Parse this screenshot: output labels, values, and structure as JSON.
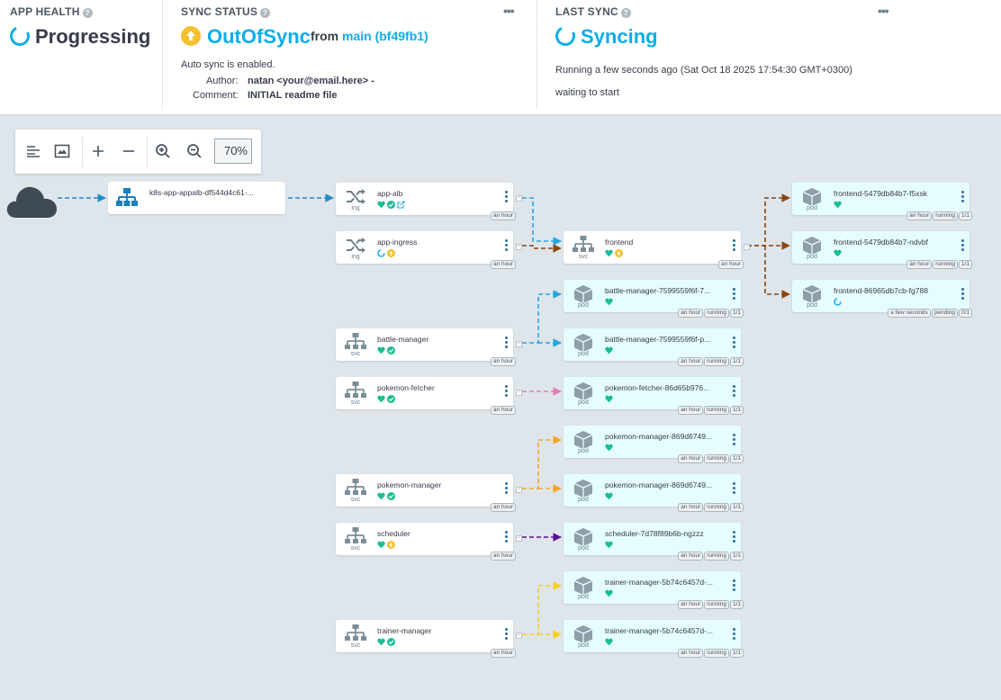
{
  "app_health": {
    "heading": "APP HEALTH",
    "status": "Progressing"
  },
  "sync_status": {
    "heading": "SYNC STATUS",
    "status": "OutOfSync",
    "from_label": "from",
    "revision": "main (bf49fb1)",
    "auto_sync": "Auto sync is enabled.",
    "author_label": "Author:",
    "author": "natan <your@email.here> -",
    "comment_label": "Comment:",
    "comment": "INITIAL readme file",
    "menu": "•••"
  },
  "last_sync": {
    "heading": "LAST SYNC",
    "status": "Syncing",
    "running": "Running a few seconds ago (Sat Oct 18 2025 17:54:30 GMT+0300)",
    "message": "waiting to start",
    "menu": "•••"
  },
  "toolbar": {
    "zoom": "70%"
  },
  "colors": {
    "accent": "#0dadea",
    "healthy": "#18be94",
    "out_of_sync": "#f4c030",
    "edge_blue": "#23a6df",
    "edge_brown": "#8b4513",
    "edge_pink": "#e27fb6",
    "edge_orange": "#f5a623",
    "edge_purple": "#5b0e8f",
    "edge_yellow": "#f2d024"
  },
  "lb": {
    "name": "k8s-app-appalb-df544d4c61-...",
    "icon": "network-icon"
  },
  "nodes": [
    {
      "id": "app-alb",
      "name": "app-alb",
      "kind": "ing",
      "icons": [
        "heart",
        "check",
        "link"
      ],
      "tags": [
        "an hour"
      ]
    },
    {
      "id": "app-ingress",
      "name": "app-ingress",
      "kind": "ing",
      "icons": [
        "progress",
        "sync"
      ],
      "tags": [
        "an hour"
      ]
    },
    {
      "id": "frontend",
      "name": "frontend",
      "kind": "svc",
      "icons": [
        "heart",
        "sync"
      ],
      "tags": [
        "an hour"
      ]
    },
    {
      "id": "fe1",
      "name": "frontend-5479db84b7-f5xsk",
      "kind": "pod",
      "icons": [
        "heart"
      ],
      "tags": [
        "an hour",
        "running",
        "1/1"
      ]
    },
    {
      "id": "fe2",
      "name": "frontend-5479db84b7-ndvbf",
      "kind": "pod",
      "icons": [
        "heart"
      ],
      "tags": [
        "an hour",
        "running",
        "1/1"
      ]
    },
    {
      "id": "fe3",
      "name": "frontend-86965db7cb-fg788",
      "kind": "pod",
      "icons": [
        "progress"
      ],
      "tags": [
        "a few seconds",
        "pending",
        "0/1"
      ]
    },
    {
      "id": "bm1",
      "name": "battle-manager-7599559f6f-7...",
      "kind": "pod",
      "icons": [
        "heart"
      ],
      "tags": [
        "an hour",
        "running",
        "1/1"
      ]
    },
    {
      "id": "battle-manager",
      "name": "battle-manager",
      "kind": "svc",
      "icons": [
        "heart",
        "check"
      ],
      "tags": [
        "an hour"
      ]
    },
    {
      "id": "bm2",
      "name": "battle-manager-7599559f6f-p...",
      "kind": "pod",
      "icons": [
        "heart"
      ],
      "tags": [
        "an hour",
        "running",
        "1/1"
      ]
    },
    {
      "id": "pokemon-fetcher",
      "name": "pokemon-fetcher",
      "kind": "svc",
      "icons": [
        "heart",
        "check"
      ],
      "tags": [
        "an hour"
      ]
    },
    {
      "id": "pf1",
      "name": "pokemon-fetcher-86d65b976...",
      "kind": "pod",
      "icons": [
        "heart"
      ],
      "tags": [
        "an hour",
        "running",
        "1/1"
      ]
    },
    {
      "id": "pm1",
      "name": "pokemon-manager-869d6749...",
      "kind": "pod",
      "icons": [
        "heart"
      ],
      "tags": [
        "an hour",
        "running",
        "1/1"
      ]
    },
    {
      "id": "pokemon-manager",
      "name": "pokemon-manager",
      "kind": "svc",
      "icons": [
        "heart",
        "check"
      ],
      "tags": [
        "an hour"
      ]
    },
    {
      "id": "pm2",
      "name": "pokemon-manager-869d6749...",
      "kind": "pod",
      "icons": [
        "heart"
      ],
      "tags": [
        "an hour",
        "running",
        "1/1"
      ]
    },
    {
      "id": "scheduler",
      "name": "scheduler",
      "kind": "svc",
      "icons": [
        "heart",
        "sync"
      ],
      "tags": [
        "an hour"
      ]
    },
    {
      "id": "sc1",
      "name": "scheduler-7d78f89b6b-ngzzz",
      "kind": "pod",
      "icons": [
        "heart"
      ],
      "tags": [
        "an hour",
        "running",
        "1/1"
      ]
    },
    {
      "id": "tm1",
      "name": "trainer-manager-5b74c6457d-...",
      "kind": "pod",
      "icons": [
        "heart"
      ],
      "tags": [
        "an hour",
        "running",
        "1/1"
      ]
    },
    {
      "id": "trainer-manager",
      "name": "trainer-manager",
      "kind": "svc",
      "icons": [
        "heart",
        "check"
      ],
      "tags": [
        "an hour"
      ]
    },
    {
      "id": "tm2",
      "name": "trainer-manager-5b74c6457d-...",
      "kind": "pod",
      "icons": [
        "heart"
      ],
      "tags": [
        "an hour",
        "running",
        "1/1"
      ]
    }
  ]
}
